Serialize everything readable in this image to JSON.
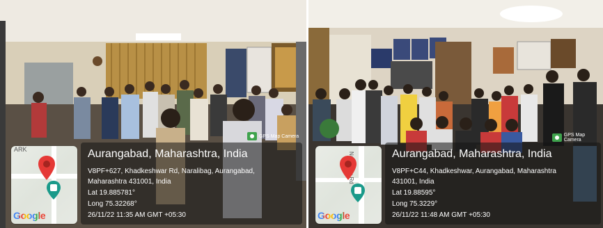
{
  "photos": [
    {
      "map_logo": "Google",
      "badge": "GPS Map Camera",
      "city": "Aurangabad, Maharashtra, India",
      "address_line1": "V8PF+627, Khadkeshwar Rd, Naralibag, Aurangabad,",
      "address_line2": "Maharashtra 431001, India",
      "lat": "Lat 19.885781°",
      "long": "Long 75.32268°",
      "datetime": "26/11/22 11:35 AM GMT +05:30",
      "map_road_label": "ARK"
    },
    {
      "map_logo": "Google",
      "badge": "GPS Map Camera",
      "city": "Aurangabad, Maharashtra, India",
      "address_line1": "V8PF+C44, Khadkeshwar, Aurangabad, Maharashtra",
      "address_line2": "431001, India",
      "lat": "Lat 19.88595°",
      "long": "Long 75.3229°",
      "datetime": "26/11/22 11:48 AM GMT +05:30",
      "map_road_label": "Naralibag Rd"
    }
  ],
  "colors": {
    "map_pin_red": "#e53935",
    "map_pin_teal": "#1a9a8a",
    "google_blue": "#4285F4",
    "google_red": "#EA4335",
    "google_yellow": "#FBBC05",
    "google_green": "#34A853"
  }
}
